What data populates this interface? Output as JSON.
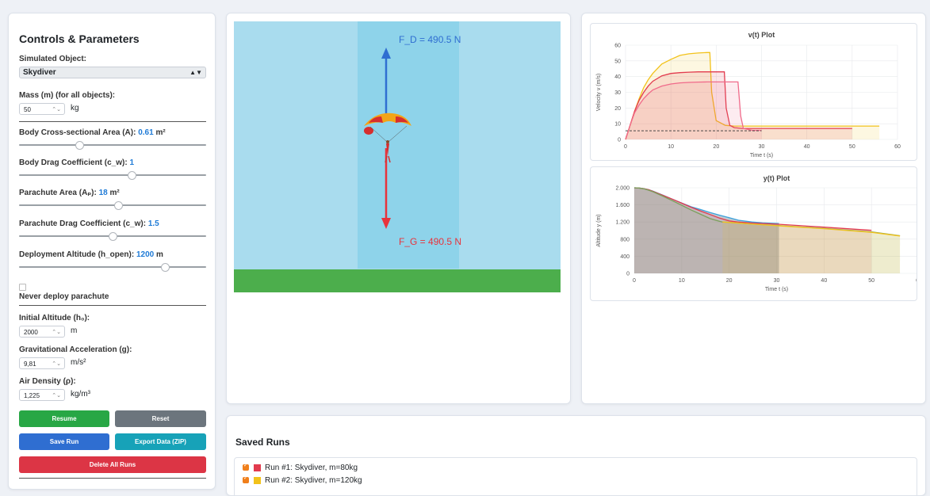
{
  "controls": {
    "title": "Controls & Parameters",
    "object_label": "Simulated Object:",
    "object_value": "Skydiver",
    "mass_label": "Mass (m) (for all objects):",
    "mass_value": "50",
    "mass_unit": "kg",
    "area_label": "Body Cross-sectional Area (A):",
    "area_value": "0.61",
    "area_unit": "m²",
    "area_fraction": 0.32,
    "drag_label": "Body Drag Coefficient (c_w):",
    "drag_value": "1",
    "drag_fraction": 0.6,
    "para_area_label": "Parachute Area (Aₚ):",
    "para_area_value": "18",
    "para_area_unit": "m²",
    "para_area_fraction": 0.53,
    "para_drag_label": "Parachute Drag Coefficient (c_w):",
    "para_drag_value": "1.5",
    "para_drag_fraction": 0.5,
    "deploy_label": "Deployment Altitude (h_open):",
    "deploy_value": "1200",
    "deploy_unit": "m",
    "deploy_fraction": 0.78,
    "never_deploy_label": "Never deploy parachute",
    "never_deploy_checked": false,
    "initial_alt_label": "Initial Altitude (h₀):",
    "initial_alt_value": "2000",
    "initial_alt_unit": "m",
    "gravity_label": "Gravitational Acceleration (g):",
    "gravity_value": "9,81",
    "gravity_unit": "m/s²",
    "density_label": "Air Density (ρ):",
    "density_value": "1,225",
    "density_unit": "kg/m³",
    "buttons": {
      "resume": "Resume",
      "reset": "Reset",
      "save": "Save Run",
      "export": "Export Data (ZIP)",
      "delete": "Delete All Runs"
    }
  },
  "simulation": {
    "drag_force_label": "F_D = 490.5 N",
    "gravity_force_label": "F_G = 490.5 N",
    "colors": {
      "sky": "#a9dcee",
      "column": "#8ed3ea",
      "ground": "#4cae4c",
      "drag_arrow": "#2f6ed1",
      "gravity_arrow": "#e8333c"
    }
  },
  "saved_runs": {
    "title": "Saved Runs",
    "runs": [
      {
        "label": "Run #1: Skydiver, m=80kg",
        "color": "#e23b4e"
      },
      {
        "label": "Run #2: Skydiver, m=120kg",
        "color": "#f2c21b"
      }
    ]
  },
  "chart_data": [
    {
      "type": "line",
      "title": "v(t) Plot",
      "xlabel": "Time t (s)",
      "ylabel": "Velocity v (m/s)",
      "xlim": [
        0,
        60
      ],
      "ylim": [
        0,
        60
      ],
      "xticks": [
        0,
        10,
        20,
        30,
        40,
        50,
        60
      ],
      "yticks": [
        0,
        10,
        20,
        30,
        40,
        50,
        60
      ],
      "grid": true,
      "series": [
        {
          "color": "#f2c21b",
          "x": [
            0,
            1,
            2,
            3,
            4,
            5,
            6,
            8,
            10,
            12,
            14,
            16,
            18,
            18.6,
            19,
            20,
            22,
            24,
            30,
            40,
            50,
            56
          ],
          "y": [
            0,
            9,
            18,
            26,
            33,
            38,
            42,
            48,
            51,
            53.5,
            54.5,
            55,
            55.3,
            55.3,
            30,
            12,
            9,
            8.5,
            8.5,
            8.5,
            8.5,
            8.5
          ]
        },
        {
          "color": "#e23b4e",
          "x": [
            0,
            1,
            2,
            3,
            4,
            5,
            6,
            8,
            10,
            12,
            14,
            16,
            18,
            20,
            21.8,
            22.2,
            23,
            24,
            26,
            30,
            40,
            50
          ],
          "y": [
            0,
            9,
            18,
            25,
            30,
            34,
            37,
            40.5,
            42,
            42.5,
            42.8,
            43,
            43,
            43,
            43,
            20,
            9,
            7.5,
            7,
            7,
            7,
            7
          ]
        },
        {
          "color": "#f06a8a",
          "x": [
            0,
            1,
            2,
            3,
            4,
            5,
            6,
            8,
            10,
            12,
            14,
            16,
            18,
            20,
            22,
            24,
            24.8,
            25.4,
            26,
            28,
            30
          ],
          "y": [
            0,
            9,
            17,
            22,
            26,
            29,
            31.5,
            34,
            35.3,
            36,
            36.3,
            36.5,
            36.6,
            36.6,
            36.6,
            36.6,
            36.6,
            15,
            7,
            5.8,
            5.8
          ]
        }
      ],
      "reference_line": {
        "y": 5.5,
        "style": "dashed"
      }
    },
    {
      "type": "area",
      "title": "y(t) Plot",
      "xlabel": "Time t (s)",
      "ylabel": "Altitude y (m)",
      "xlim": [
        0,
        60
      ],
      "ylim": [
        0,
        2000
      ],
      "xticks": [
        0,
        10,
        20,
        30,
        40,
        50,
        60
      ],
      "yticks": [
        0,
        400,
        800,
        1200,
        1600,
        2000
      ],
      "ytick_labels": [
        "0",
        "400",
        "800",
        "1.200",
        "1.600",
        "2.000"
      ],
      "grid": true,
      "series": [
        {
          "color": "#3aa1dc",
          "x": [
            0,
            1,
            2,
            3,
            4,
            6,
            8,
            10,
            12,
            14,
            16,
            18,
            20,
            22,
            24.8,
            27,
            30.5
          ],
          "y": [
            2000,
            1995,
            1980,
            1955,
            1920,
            1830,
            1735,
            1645,
            1555,
            1490,
            1420,
            1360,
            1300,
            1240,
            1200,
            1180,
            1165
          ]
        },
        {
          "color": "#e23b4e",
          "x": [
            0,
            1,
            2,
            3,
            4,
            6,
            8,
            10,
            12,
            14,
            16,
            18,
            20,
            21.8,
            25,
            30,
            40,
            50
          ],
          "y": [
            2000,
            1995,
            1980,
            1955,
            1915,
            1825,
            1735,
            1640,
            1545,
            1455,
            1375,
            1290,
            1225,
            1200,
            1175,
            1150,
            1080,
            1005
          ]
        },
        {
          "color": "#7aa05a",
          "x": [
            0,
            1,
            2,
            3,
            4,
            6,
            8,
            10,
            12,
            14,
            16,
            18,
            18.6,
            20,
            25,
            30,
            40,
            50,
            56
          ],
          "y": [
            2000,
            1994,
            1975,
            1945,
            1905,
            1805,
            1700,
            1590,
            1480,
            1380,
            1280,
            1215,
            1200,
            1190,
            1150,
            1120,
            1050,
            970,
            880
          ]
        },
        {
          "color": "#f2c21b",
          "x": [
            18.6,
            20,
            25,
            30,
            40,
            50,
            56
          ],
          "y": [
            1200,
            1190,
            1150,
            1115,
            1045,
            960,
            875
          ]
        }
      ]
    }
  ]
}
